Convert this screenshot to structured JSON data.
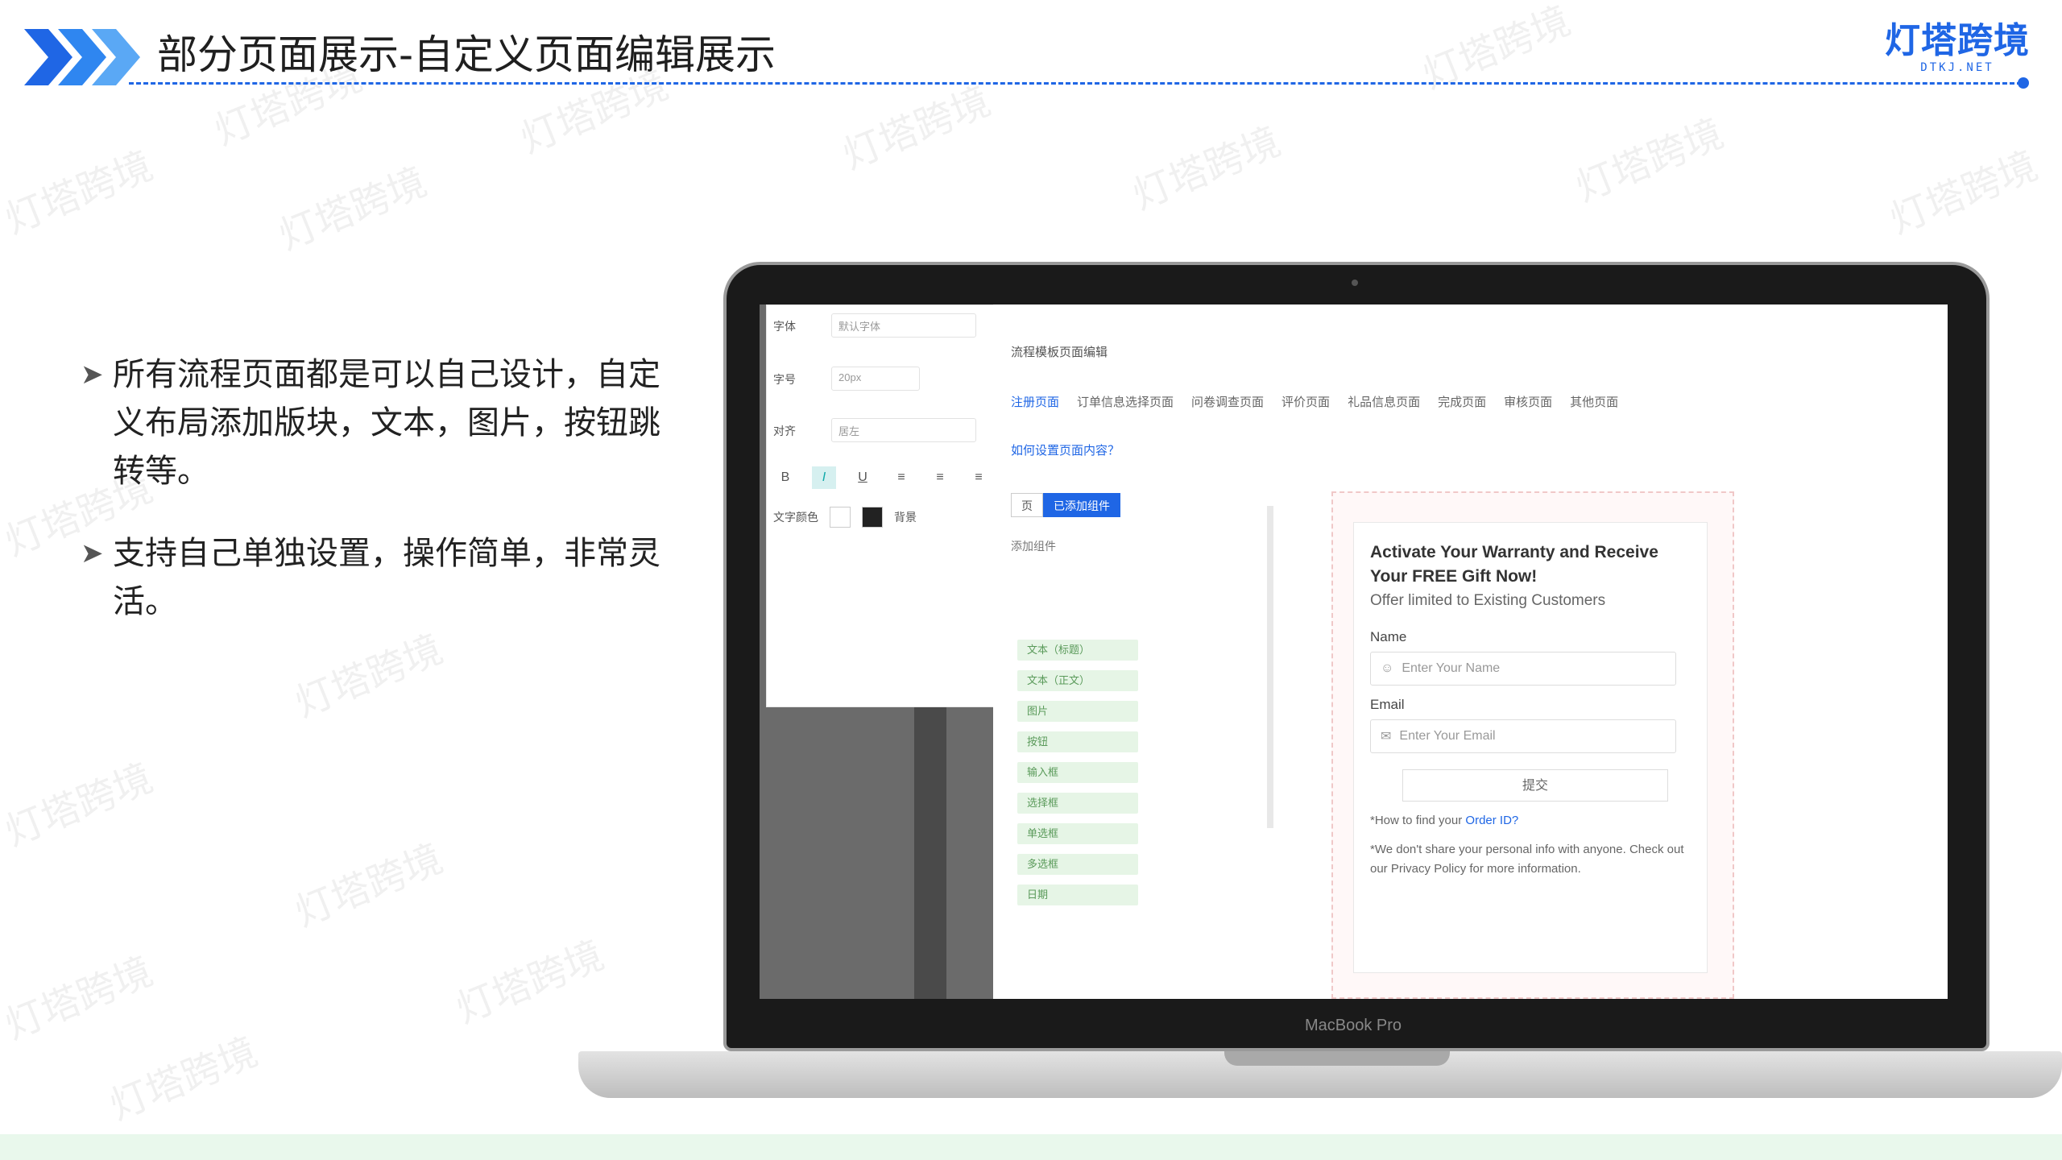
{
  "header": {
    "title": "部分页面展示-自定义页面编辑展示",
    "logo_text": "灯塔跨境",
    "logo_sub": "DTKJ.NET",
    "accent_color": "#1f66e5"
  },
  "watermark": "灯塔跨境",
  "bullets": [
    {
      "text": "所有流程页面都是可以自己设计，自定义布局添加版块，文本，图片，按钮跳转等。"
    },
    {
      "text": "支持自己单独设置，操作简单，非常灵活。"
    }
  ],
  "laptop": {
    "brand": "MacBook Pro"
  },
  "screen": {
    "breadcrumb": "流程模板页面编辑",
    "step_tabs": [
      {
        "label": "注册页面"
      },
      {
        "label": "订单信息选择页面"
      },
      {
        "label": "问卷调查页面"
      },
      {
        "label": "评价页面"
      },
      {
        "label": "礼品信息页面"
      },
      {
        "label": "完成页面"
      },
      {
        "label": "审核页面"
      },
      {
        "label": "其他页面"
      }
    ],
    "help_link": "如何设置页面内容？",
    "tabs": [
      {
        "label": "页"
      },
      {
        "label": "已添加组件"
      }
    ],
    "components_label": "添加组件",
    "components": [
      {
        "label": "文本（标题）"
      },
      {
        "label": "文本（正文）"
      },
      {
        "label": "图片"
      },
      {
        "label": "按钮"
      },
      {
        "label": "输入框"
      },
      {
        "label": "选择框"
      },
      {
        "label": "单选框"
      },
      {
        "label": "多选框"
      },
      {
        "label": "日期"
      }
    ],
    "settings": {
      "font_label": "字体",
      "font_value": "默认字体",
      "size_label": "字号",
      "size_value": "20px",
      "align_label": "对齐",
      "align_value": "居左",
      "color_label": "文字颜色",
      "bg_label": "背景"
    },
    "form": {
      "title": "Activate Your Warranty and Receive Your FREE Gift Now!",
      "subtitle": "Offer limited to Existing Customers",
      "name_label": "Name",
      "name_placeholder": "Enter Your Name",
      "email_label": "Email",
      "email_placeholder": "Enter Your Email",
      "submit_label": "提交",
      "note_prefix": "*How to find your",
      "note_link": "Order ID?",
      "note_body": "*We don't share your personal info with anyone. Check out our Privacy Policy for more information."
    }
  }
}
